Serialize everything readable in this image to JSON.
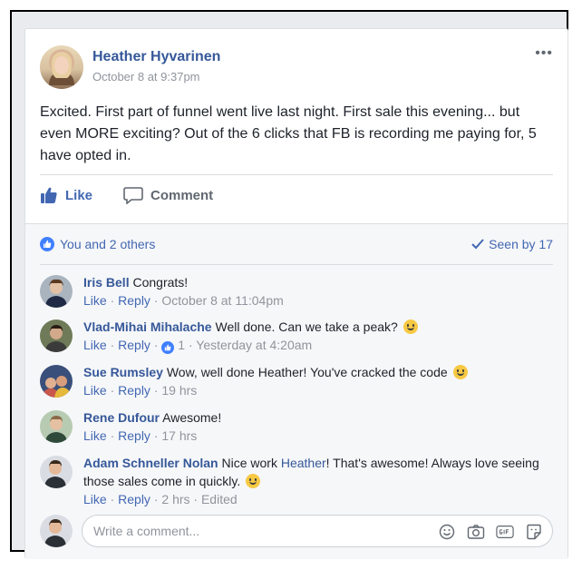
{
  "post": {
    "author": "Heather Hyvarinen",
    "timestamp": "October 8 at 9:37pm",
    "menu_glyph": "•••",
    "text": "Excited. First part of funnel went live last night. First sale this evening... but even MORE exciting? Out of the 6 clicks that FB is recording me paying for, 5 have opted in."
  },
  "actions": {
    "like": "Like",
    "comment": "Comment"
  },
  "reactions": {
    "summary": "You and 2 others",
    "seen": "Seen by 17"
  },
  "comments": [
    {
      "name": "Iris Bell",
      "text": "Congrats!",
      "like": "Like",
      "reply": "Reply",
      "time": "October 8 at 11:04pm"
    },
    {
      "name": "Vlad-Mihai Mihalache",
      "text": "Well done. Can we take a peak?",
      "like": "Like",
      "reply": "Reply",
      "reaction_count": "1",
      "time": "Yesterday at 4:20am"
    },
    {
      "name": "Sue Rumsley",
      "text": "Wow, well done Heather! You've cracked the code",
      "like": "Like",
      "reply": "Reply",
      "time": "19 hrs"
    },
    {
      "name": "Rene Dufour",
      "text": "Awesome!",
      "like": "Like",
      "reply": "Reply",
      "time": "17 hrs"
    },
    {
      "name": "Adam Schneller Nolan",
      "text_before": "Nice work",
      "mention": "Heather",
      "text_after": "! That's awesome! Always love seeing those sales come in quickly.",
      "like": "Like",
      "reply": "Reply",
      "time": "2 hrs",
      "edited": "Edited"
    }
  ],
  "composer": {
    "placeholder": "Write a comment..."
  },
  "icons": [
    "thumbs-up-icon",
    "comment-bubble-icon",
    "checkmark-icon",
    "emoji-icon",
    "camera-icon",
    "gif-icon",
    "sticker-icon",
    "more-options-icon"
  ],
  "colors": {
    "link": "#365899",
    "accent": "#4267b2",
    "like_blue": "#4080ff",
    "muted": "#90949c"
  }
}
